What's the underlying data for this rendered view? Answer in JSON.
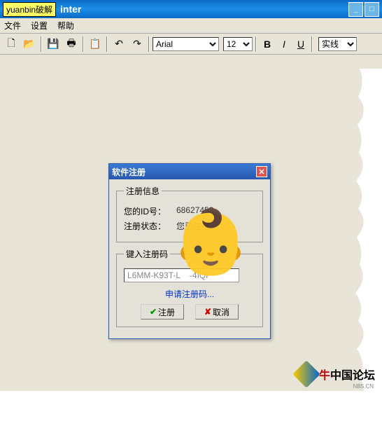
{
  "watermark_badge": "yuanbin破解",
  "window_title": "inter",
  "menu": {
    "file": "文件",
    "settings": "设置",
    "help": "帮助"
  },
  "toolbar": {
    "font": "Arial",
    "size": "12",
    "linestyle": "实线"
  },
  "dialog": {
    "title": "软件注册",
    "info_legend": "注册信息",
    "id_label": "您的ID号：",
    "id_value": "68627453",
    "status_label": "注册状态：",
    "status_value": "您已注册",
    "enter_legend": "键入注册码",
    "code_value": "L6MM-K93T-L    -4IQF",
    "apply_link": "申请注册码...",
    "register_btn": "注册",
    "cancel_btn": "取消"
  },
  "footer": {
    "brand1": "牛",
    "brand2": "中国论坛",
    "url": "NB5.CN"
  }
}
